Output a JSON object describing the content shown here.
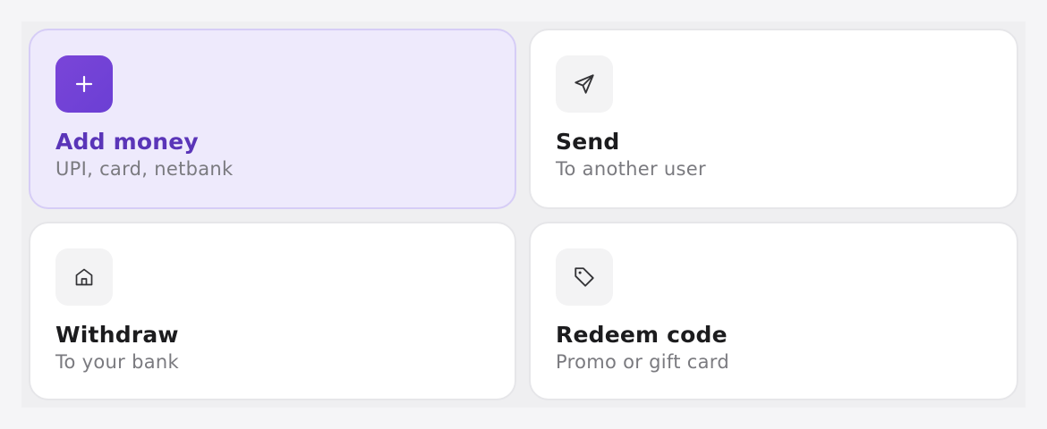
{
  "actions": [
    {
      "title": "Add money",
      "subtitle": "UPI, card, netbank",
      "icon": "plus-icon",
      "selected": true
    },
    {
      "title": "Send",
      "subtitle": "To another user",
      "icon": "send-icon",
      "selected": false
    },
    {
      "title": "Withdraw",
      "subtitle": "To your bank",
      "icon": "home-icon",
      "selected": false
    },
    {
      "title": "Redeem code",
      "subtitle": "Promo or gift card",
      "icon": "tag-icon",
      "selected": false
    }
  ],
  "colors": {
    "accent": "#6b3fd4",
    "selected_bg": "#eeeafc",
    "selected_title": "#5a35b8"
  }
}
